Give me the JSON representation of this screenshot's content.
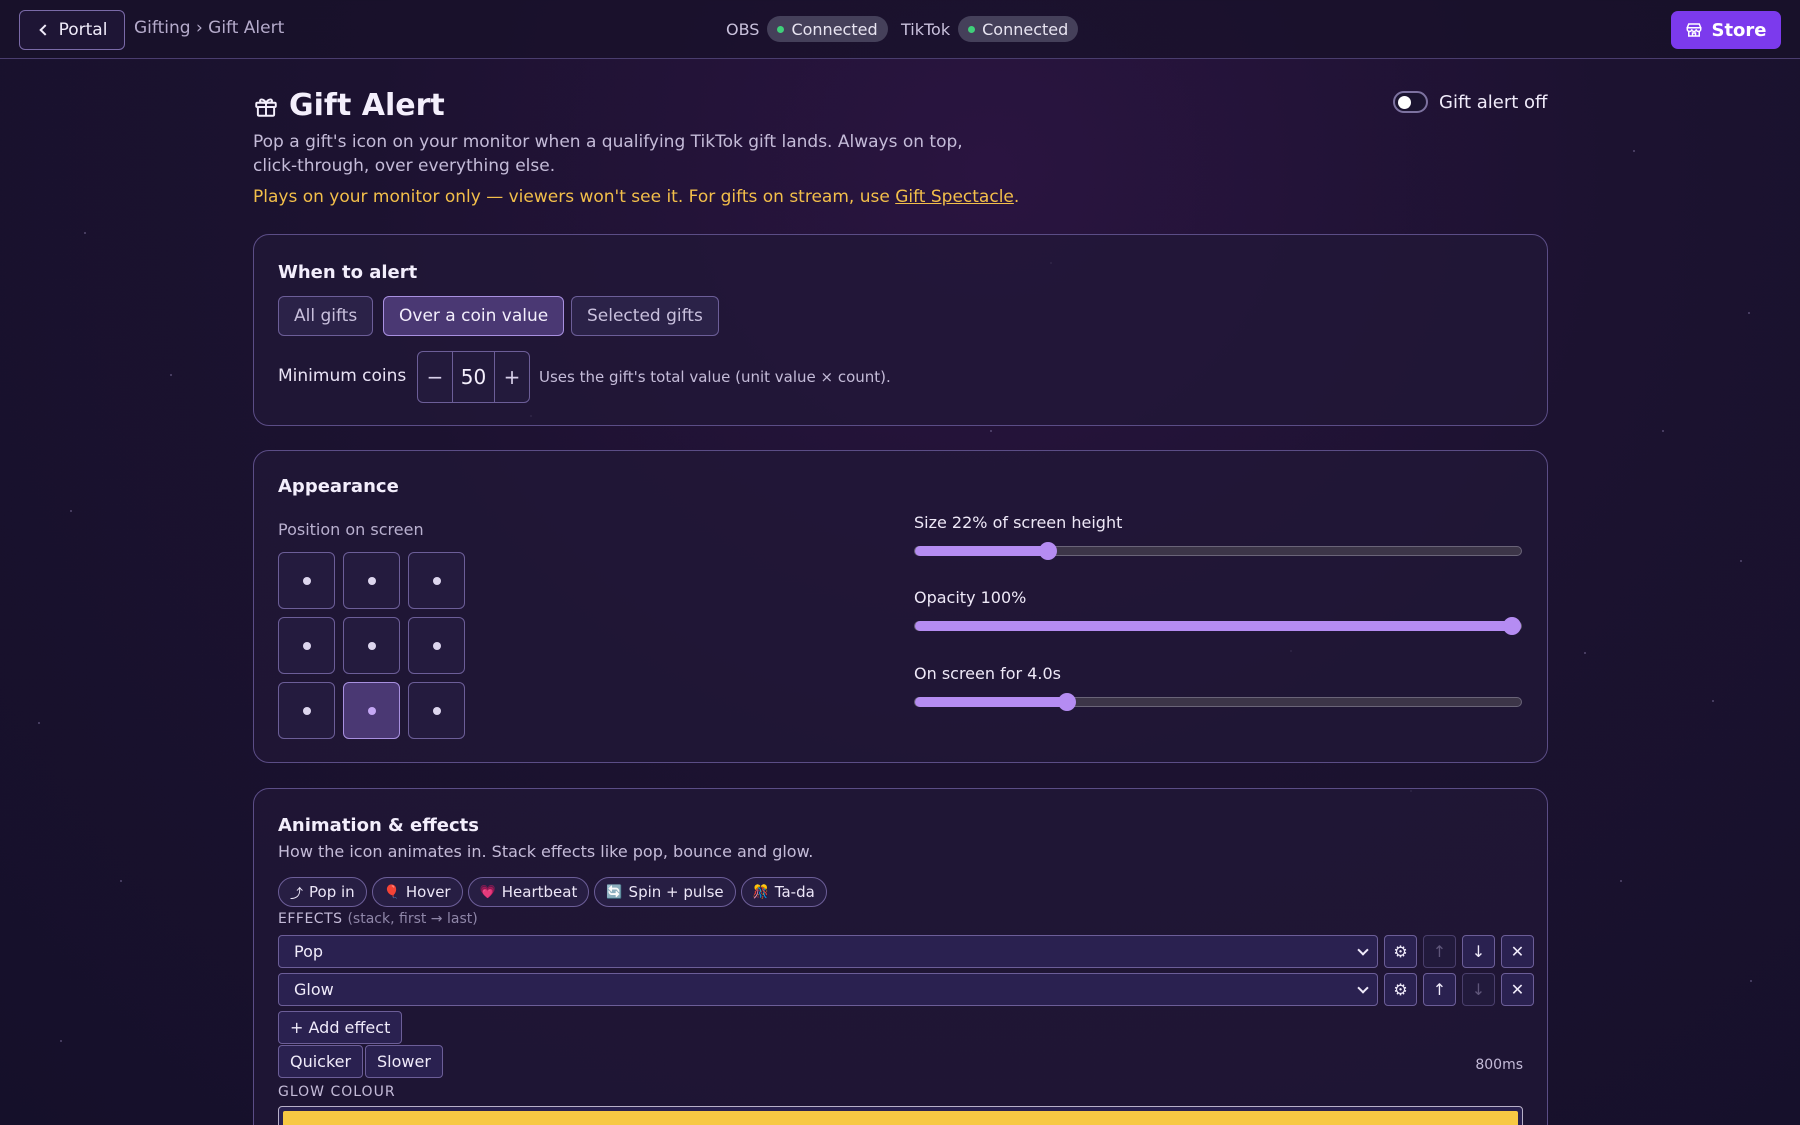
{
  "topbar": {
    "portal_label": "Portal",
    "breadcrumb": "Gifting › Gift Alert",
    "obs_label": "OBS",
    "obs_status": "Connected",
    "tiktok_label": "TikTok",
    "tiktok_status": "Connected",
    "store_label": "Store"
  },
  "header": {
    "title": "Gift Alert",
    "description": "Pop a gift's icon on your monitor when a qualifying TikTok gift lands. Always on top, click-through, over everything else.",
    "warning_prefix": "Plays on your monitor only — viewers won't see it. For gifts on stream, use ",
    "warning_link": "Gift Spectacle",
    "warning_suffix": ".",
    "toggle_label": "Gift alert off",
    "toggle_on": false
  },
  "when": {
    "title": "When to alert",
    "modes": [
      "All gifts",
      "Over a coin value",
      "Selected gifts"
    ],
    "active_mode": "Over a coin value",
    "min_label": "Minimum coins",
    "min_value": "50",
    "minus": "−",
    "plus": "+",
    "hint": "Uses the gift's total value (unit value × count)."
  },
  "appearance": {
    "title": "Appearance",
    "position_label": "Position on screen",
    "selected_position": "bottom-center",
    "sliders": [
      {
        "label": "Size 22% of screen height",
        "value": 22,
        "min": 0,
        "max": 100
      },
      {
        "label": "Opacity 100%",
        "value": 100,
        "min": 0,
        "max": 100
      },
      {
        "label": "On screen for 4.0s",
        "value": 4.0,
        "min": 0,
        "max": 16
      }
    ]
  },
  "animation": {
    "title": "Animation & effects",
    "description": "How the icon animates in. Stack effects like pop, bounce and glow.",
    "presets": [
      {
        "emoji": "⤴",
        "label": "Pop in"
      },
      {
        "emoji": "🎈",
        "label": "Hover"
      },
      {
        "emoji": "💗",
        "label": "Heartbeat"
      },
      {
        "emoji": "🔄",
        "label": "Spin + pulse"
      },
      {
        "emoji": "🎊",
        "label": "Ta-da"
      }
    ],
    "effects_label": "EFFECTS",
    "effects_note": "(stack, first → last)",
    "effects": [
      {
        "name": "Pop",
        "up_enabled": false,
        "down_enabled": true
      },
      {
        "name": "Glow",
        "up_enabled": true,
        "down_enabled": false
      }
    ],
    "gear": "⚙",
    "up": "↑",
    "down": "↓",
    "remove": "✕",
    "add_effect": "+ Add effect",
    "quicker": "Quicker",
    "slower": "Slower",
    "duration": "800ms",
    "glow_label": "GLOW COLOUR",
    "glow_color": "#f7c843"
  }
}
